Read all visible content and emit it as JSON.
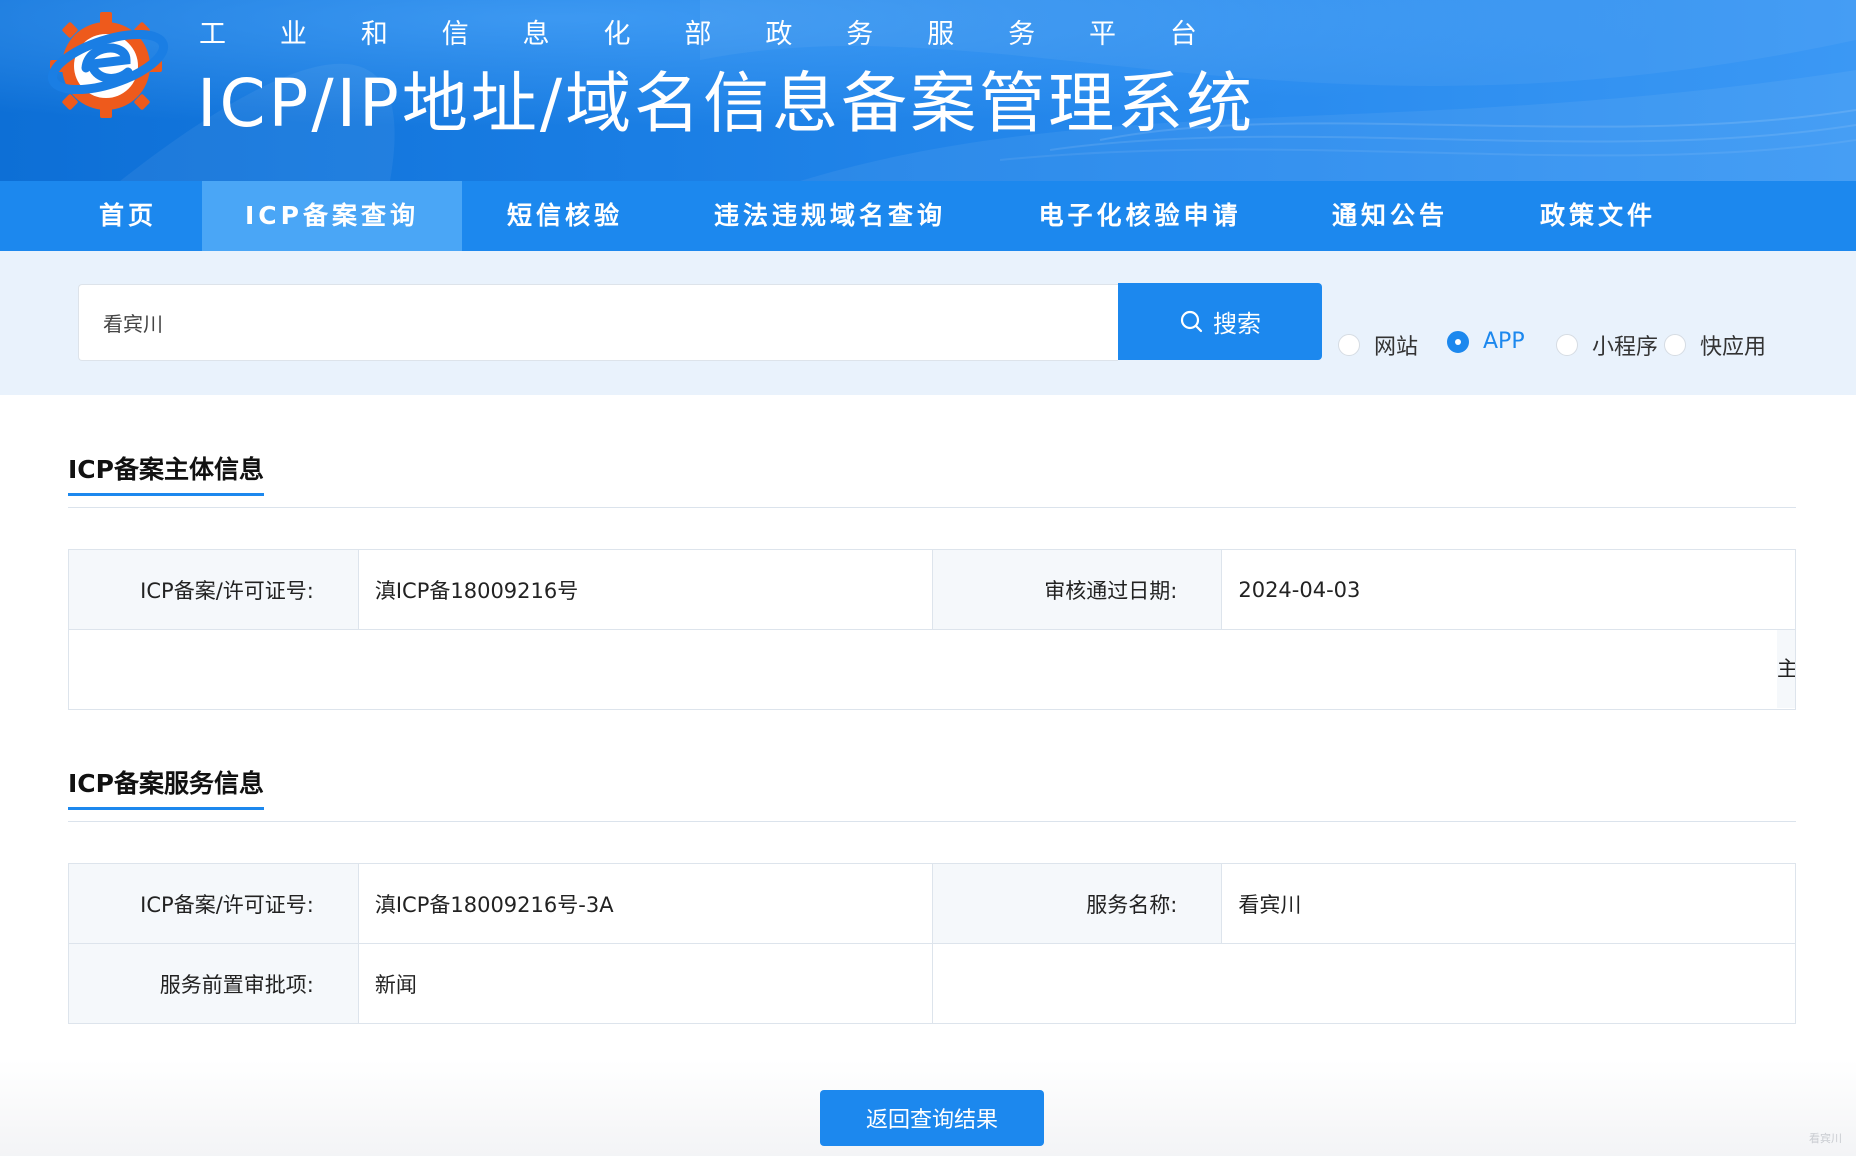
{
  "header": {
    "platform_chars": [
      "工",
      "业",
      "和",
      "信",
      "息",
      "化",
      "部",
      "政",
      "务",
      "服",
      "务",
      "平",
      "台"
    ],
    "title": "ICP/IP地址/域名信息备案管理系统",
    "logo": "miit-gear-logo"
  },
  "nav": {
    "items": [
      {
        "label": "首页"
      },
      {
        "label": "ICP备案查询",
        "active": true
      },
      {
        "label": "短信核验"
      },
      {
        "label": "违法违规域名查询"
      },
      {
        "label": "电子化核验申请"
      },
      {
        "label": "通知公告"
      },
      {
        "label": "政策文件"
      }
    ]
  },
  "search": {
    "value": "看宾川",
    "button_label": "搜索",
    "icon": "search-icon",
    "types": [
      {
        "label": "网站",
        "checked": false
      },
      {
        "label": "APP",
        "checked": true
      },
      {
        "label": "小程序",
        "checked": false
      },
      {
        "label": "快应用",
        "checked": false
      }
    ]
  },
  "subject_info": {
    "title": "ICP备案主体信息",
    "license_label": "ICP备案/许可证号:",
    "license_value": "滇ICP备18009216号",
    "date_label": "审核通过日期:",
    "date_value": "2024-04-03",
    "clipped_char": "主"
  },
  "service_info": {
    "title": "ICP备案服务信息",
    "license_label": "ICP备案/许可证号:",
    "license_value": "滇ICP备18009216号-3A",
    "name_label": "服务名称:",
    "name_value": "看宾川",
    "approval_label": "服务前置审批项:",
    "approval_value": "新闻"
  },
  "footer": {
    "back_label": "返回查询结果",
    "watermark": "看宾川"
  },
  "colors": {
    "primary": "#1c88ee",
    "nav_active": "#4aa6f6",
    "search_band": "#e9f2fc",
    "logo_orange": "#ee5a1c"
  }
}
